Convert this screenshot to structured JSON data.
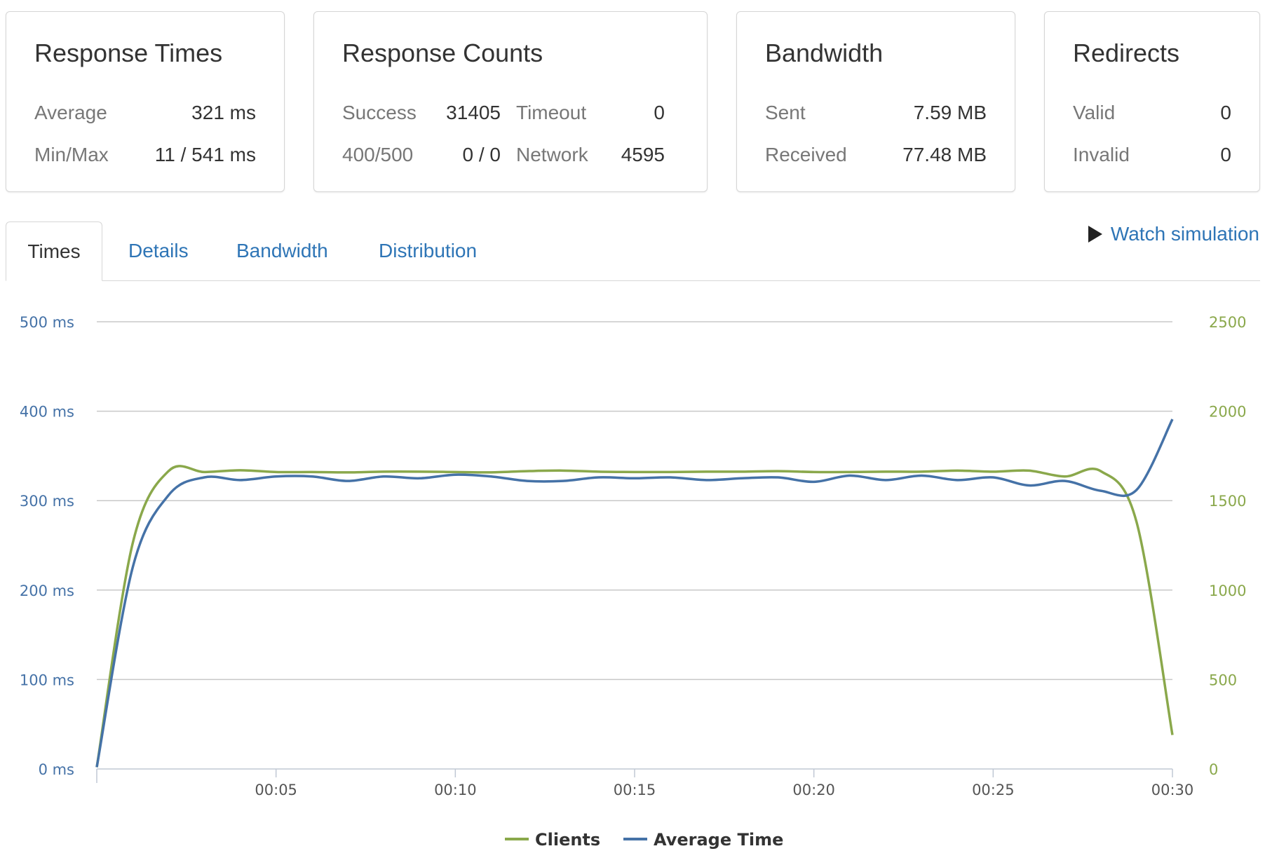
{
  "cards": {
    "response_times": {
      "title": "Response Times",
      "rows": [
        {
          "label": "Average",
          "value": "321 ms"
        },
        {
          "label": "Min/Max",
          "value": "11 / 541 ms"
        }
      ]
    },
    "response_counts": {
      "title": "Response Counts",
      "rows": [
        {
          "label": "Success",
          "value": "31405",
          "label2": "Timeout",
          "value2": "0"
        },
        {
          "label": "400/500",
          "value": "0 / 0",
          "label2": "Network",
          "value2": "4595"
        }
      ]
    },
    "bandwidth": {
      "title": "Bandwidth",
      "rows": [
        {
          "label": "Sent",
          "value": "7.59 MB"
        },
        {
          "label": "Received",
          "value": "77.48 MB"
        }
      ]
    },
    "redirects": {
      "title": "Redirects",
      "rows": [
        {
          "label": "Valid",
          "value": "0"
        },
        {
          "label": "Invalid",
          "value": "0"
        }
      ]
    }
  },
  "tabs": [
    {
      "label": "Times",
      "active": true
    },
    {
      "label": "Details",
      "active": false
    },
    {
      "label": "Bandwidth",
      "active": false
    },
    {
      "label": "Distribution",
      "active": false
    }
  ],
  "watch_label": "Watch simulation",
  "icons": {
    "watch": "play-icon"
  },
  "colors": {
    "clients": "#8aa84b",
    "average_time": "#4572a7",
    "link": "#2e75b6"
  },
  "chart_data": {
    "type": "line",
    "title": "",
    "grid": true,
    "legend_position": "bottom-center",
    "x": [
      "00:00",
      "00:01",
      "00:02",
      "00:03",
      "00:04",
      "00:05",
      "00:06",
      "00:07",
      "00:08",
      "00:09",
      "00:10",
      "00:11",
      "00:12",
      "00:13",
      "00:14",
      "00:15",
      "00:16",
      "00:17",
      "00:18",
      "00:19",
      "00:20",
      "00:21",
      "00:22",
      "00:23",
      "00:24",
      "00:25",
      "00:26",
      "00:27",
      "00:28",
      "00:29",
      "00:30"
    ],
    "x_tick_labels": [
      "00:05",
      "00:10",
      "00:15",
      "00:20",
      "00:25",
      "00:30"
    ],
    "y_left": {
      "ticks": [
        "0 ms",
        "100 ms",
        "200 ms",
        "300 ms",
        "400 ms",
        "500 ms"
      ],
      "range": [
        0,
        500
      ],
      "unit": "ms"
    },
    "y_right": {
      "ticks": [
        "0",
        "500",
        "1000",
        "1500",
        "2000",
        "2500"
      ],
      "range": [
        0,
        2500
      ]
    },
    "series": [
      {
        "name": "Clients",
        "axis": "right",
        "values": [
          10,
          1260,
          1665,
          1660,
          1670,
          1660,
          1660,
          1658,
          1662,
          1662,
          1660,
          1658,
          1665,
          1668,
          1662,
          1660,
          1660,
          1662,
          1662,
          1665,
          1660,
          1660,
          1662,
          1662,
          1668,
          1662,
          1668,
          1635,
          1665,
          1380,
          190
        ]
      },
      {
        "name": "Average Time",
        "axis": "left",
        "values": [
          2,
          225,
          306,
          326,
          323,
          327,
          327,
          322,
          327,
          325,
          329,
          327,
          322,
          322,
          326,
          325,
          326,
          323,
          325,
          326,
          321,
          328,
          323,
          328,
          323,
          326,
          317,
          322,
          311,
          312,
          391
        ]
      }
    ]
  }
}
